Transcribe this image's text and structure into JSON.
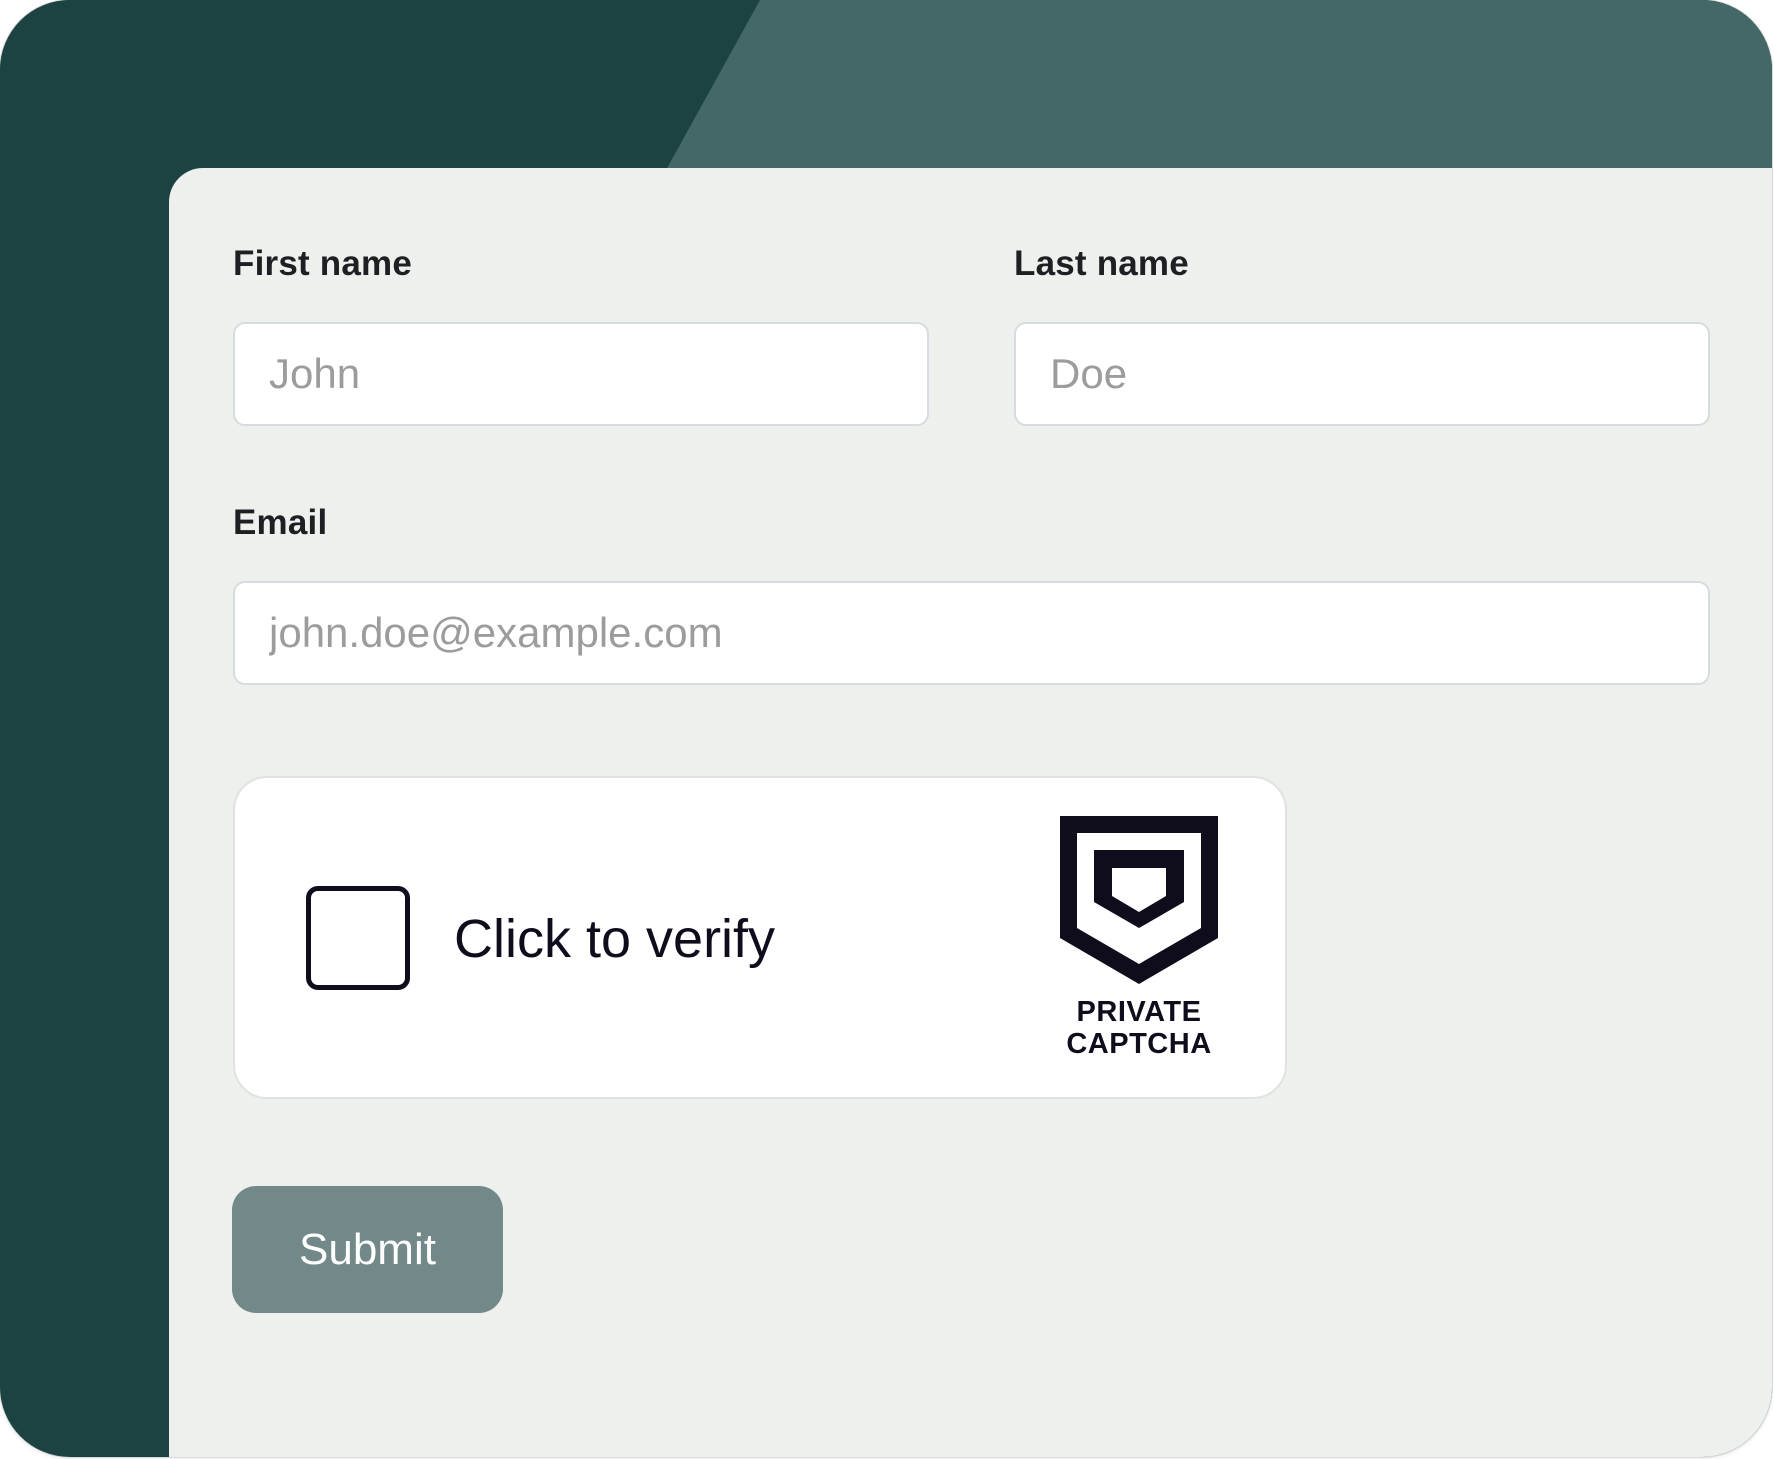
{
  "form": {
    "first_name": {
      "label": "First name",
      "placeholder": "John"
    },
    "last_name": {
      "label": "Last name",
      "placeholder": "Doe"
    },
    "email": {
      "label": "Email",
      "placeholder": "john.doe@example.com"
    },
    "submit_label": "Submit"
  },
  "captcha": {
    "checkbox_label": "Click to verify",
    "brand_line1": "PRIVATE",
    "brand_line2": "CAPTCHA",
    "icon": "shield-logo-icon"
  },
  "colors": {
    "background_dark": "#1c4342",
    "header_light": "#446865",
    "panel": "#eef0ed",
    "button": "#738888",
    "text": "#1d1f22"
  }
}
